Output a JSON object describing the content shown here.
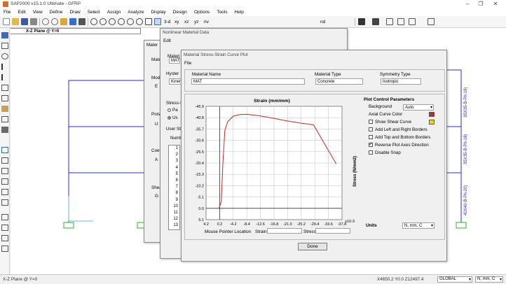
{
  "app": {
    "title": "SAP2000 v15.1.0 Ultimate  - GFRP"
  },
  "menu": [
    "File",
    "Edit",
    "View",
    "Define",
    "Draw",
    "Select",
    "Assign",
    "Analyze",
    "Display",
    "Design",
    "Options",
    "Tools",
    "Help"
  ],
  "toolbar": {
    "zoom_text": "3-d",
    "xy_text": "xy",
    "xz_text": "xz",
    "yz_text": "yz",
    "nv_text": "nv",
    "nd_text": "nd"
  },
  "view": {
    "title": "X-Z Plane @ Y=0",
    "section_labels": [
      "35X35-B-Ph-18)",
      "35X35-B-Ph-18)",
      "40X40-B-Ph-20)"
    ]
  },
  "status": {
    "left": "X-Z Plane @ Y=0",
    "coords": "X4650.2  Y0.0  Z12497.4",
    "coord_sys": "GLOBAL",
    "units": "N, mm, C"
  },
  "nonlinear_dialog": {
    "title": "Nonlinear Material Data",
    "menu": "Edit"
  },
  "behind_dialog": {
    "tab": "Mater",
    "mat_label": "Materi",
    "mat_value": "MAT",
    "modulus_label": "Modu",
    "modulus_value": "E",
    "poisson_label": "Poiss",
    "poisson_value": "U",
    "coeff_label": "Coeff",
    "coeff_value": "A",
    "shear_label": "Shea",
    "shear_value": "G",
    "hyst_label": "Hyster",
    "hyst_value": "Kinem",
    "stress_label": "Stress-S",
    "opt1": "Pa",
    "opt2": "Us",
    "userstr_label": "User St",
    "number_label": "Numbe"
  },
  "row_numbers": [
    "1",
    "2",
    "3",
    "4",
    "5",
    "6",
    "7",
    "8",
    "9",
    "10",
    "11",
    "12",
    "13"
  ],
  "plot_dialog": {
    "title": "Material Stress-Strain Curve Plot",
    "menu": "File",
    "material_name_label": "Material Name",
    "material_name_value": "MAT",
    "material_type_label": "Material Type",
    "material_type_value": "Concrete",
    "symmetry_label": "Symmetry Type",
    "symmetry_value": "Isotropic",
    "params_title": "Plot Control Parameters",
    "background_label": "Background",
    "background_value": "Auto",
    "axial_color_label": "Axial Curve Color",
    "axial_color": "#c62828",
    "shear_curve_label": "Show Shear Curve",
    "shear_color": "#f2d21d",
    "checks": [
      {
        "label": "Add Left and Right Borders",
        "checked": false
      },
      {
        "label": "Add Top and Bottom Borders",
        "checked": false
      },
      {
        "label": "Reverse Plot Axes Direction",
        "checked": true
      },
      {
        "label": "Disable Snap",
        "checked": false
      }
    ],
    "units_label": "Units",
    "units_value": "N, mm, C",
    "mouse_label": "Mouse Pointer Location",
    "strain_label": "Strain",
    "stress_label": "Stress",
    "done_label": "Done"
  },
  "chart_data": {
    "type": "line",
    "title": "Strain    (mm/mm)",
    "ylabel": "Stress     (N/mm2)",
    "x_scale_label": "x10-3",
    "x_ticks": [
      "4.2",
      "0.2",
      "-4.2",
      "-8.4",
      "-12.6",
      "-16.8",
      "-21.0",
      "-25.2",
      "-29.4",
      "-33.6",
      "-37.8"
    ],
    "y_ticks": [
      "-45.9",
      "-40.8",
      "-35.7",
      "-30.6",
      "-25.5",
      "-20.4",
      "-15.3",
      "-10.2",
      "-5.1",
      "0.0",
      "5.1"
    ],
    "xlim": [
      4.2,
      -37.8
    ],
    "ylim": [
      5.1,
      -45.9
    ],
    "series": [
      {
        "color": "#c62828",
        "x": [
          0.2,
          -0.5,
          -1.0,
          -1.6,
          -2.5,
          -4.2,
          -6.3,
          -8.4,
          -12.6,
          -16.8,
          -21.0,
          -25.2,
          -29.0,
          -32.0,
          -36.0
        ],
        "y": [
          0.0,
          -3.0,
          -20.0,
          -35.0,
          -39.0,
          -41.5,
          -42.2,
          -42.3,
          -41.6,
          -40.5,
          -39.3,
          -38.3,
          -37.6,
          -30.0,
          -20.0
        ]
      }
    ]
  }
}
